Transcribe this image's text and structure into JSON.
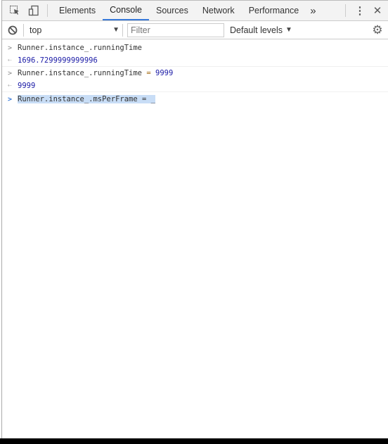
{
  "tabs": [
    {
      "label": "Elements"
    },
    {
      "label": "Console",
      "active": true
    },
    {
      "label": "Sources"
    },
    {
      "label": "Network"
    },
    {
      "label": "Performance"
    }
  ],
  "more_tabs": "»",
  "toolbar": {
    "context": "top",
    "filter_placeholder": "Filter",
    "levels": "Default levels"
  },
  "console": {
    "l1": "Runner.instance_.runningTime",
    "r1": "1696.7299999999996",
    "l2": "Runner.instance_.runningTime",
    "l2op": "=",
    "l2val": "9999",
    "r2": "9999",
    "input": "Runner.instance_.msPerFrame = _"
  },
  "colors": {
    "accent": "#3879d9",
    "number": "#1a1aa6",
    "selection": "#c8ddf6"
  }
}
